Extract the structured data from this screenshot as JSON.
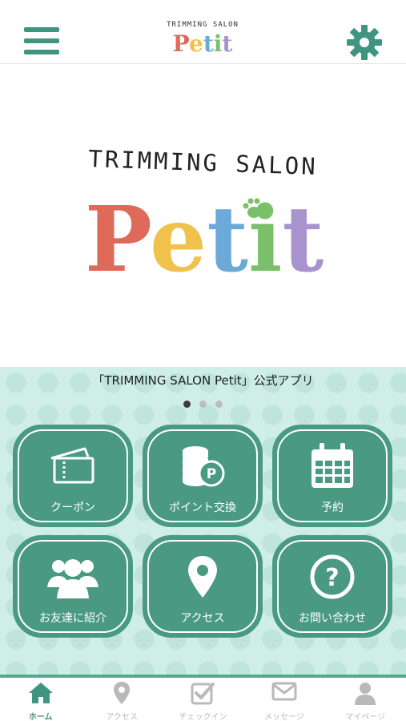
{
  "header": {
    "logo_small": "TRIMMING SALON",
    "logo_main": "Petit"
  },
  "hero": {
    "logo_small": "TRIMMING SALON",
    "logo_main": "Petit"
  },
  "carousel": {
    "caption": "「TRIMMING SALON Petit」公式アプリ",
    "page_count": 3,
    "active_page": 1
  },
  "tiles": [
    {
      "label": "クーポン",
      "icon": "coupon-ticket-icon"
    },
    {
      "label": "ポイント交換",
      "icon": "coin-points-icon"
    },
    {
      "label": "予約",
      "icon": "calendar-icon"
    },
    {
      "label": "お友達に紹介",
      "icon": "people-group-icon"
    },
    {
      "label": "アクセス",
      "icon": "map-pin-icon"
    },
    {
      "label": "お問い合わせ",
      "icon": "question-circle-icon"
    }
  ],
  "bottom_nav": [
    {
      "label": "ホーム",
      "icon": "home-icon",
      "active": true
    },
    {
      "label": "アクセス",
      "icon": "map-pin-icon",
      "active": false
    },
    {
      "label": "チェックイン",
      "icon": "checkbox-icon",
      "active": false
    },
    {
      "label": "メッセージ",
      "icon": "mail-icon",
      "active": false
    },
    {
      "label": "マイページ",
      "icon": "user-icon",
      "active": false
    }
  ],
  "colors": {
    "brand_green": "#3f9580",
    "tile_green": "#4a9a82",
    "panel_bg": "#cfeee6",
    "nav_inactive": "#b9b9b9",
    "logo_p": "#e06a5a",
    "logo_e": "#f0c14b",
    "logo_t1": "#6aa9d8",
    "logo_i": "#7ac06a",
    "logo_t2": "#a893cf"
  }
}
